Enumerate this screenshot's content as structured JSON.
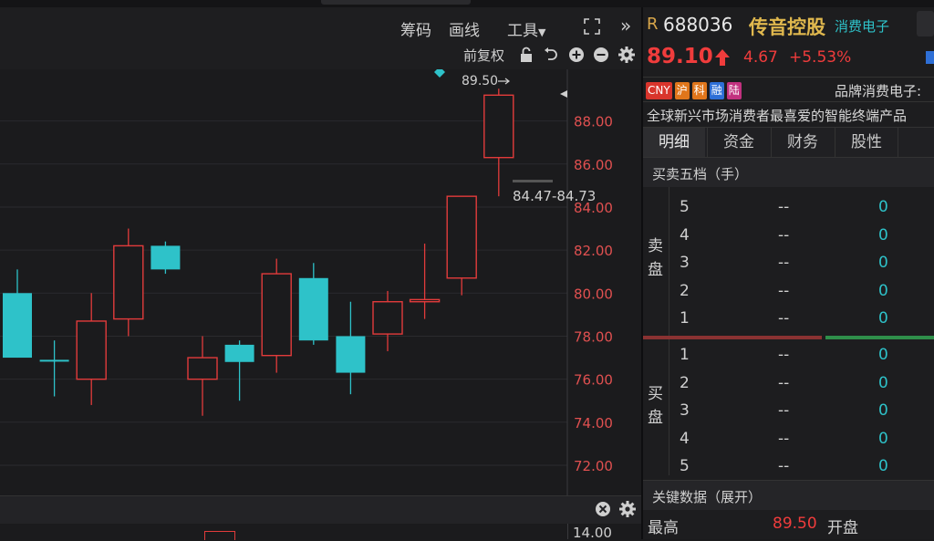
{
  "toolbar": {
    "chips_label": "筹码",
    "draw_label": "画线",
    "tools_label": "工具",
    "adjust_label": "前复权",
    "collapse_symbol": "»"
  },
  "chart": {
    "high_marker": "89.50",
    "range_label": "84.47-84.73",
    "y_ticks": [
      "88.00",
      "86.00",
      "84.00",
      "82.00",
      "80.00",
      "78.00",
      "76.00",
      "74.00",
      "72.00"
    ],
    "lower_first_tick": "14.00"
  },
  "chart_data": {
    "type": "candlestick",
    "ylim": [
      70.6,
      90.4
    ],
    "up_color": "#e23b3b",
    "down_color": "#2ec2c9",
    "candles": [
      {
        "o": 77.0,
        "c": 80.0,
        "h": 81.1,
        "l": 77.0,
        "dir": "down"
      },
      {
        "o": 76.9,
        "c": 76.9,
        "h": 77.8,
        "l": 75.2,
        "dir": "down"
      },
      {
        "o": 76.0,
        "c": 78.7,
        "h": 80.0,
        "l": 74.8,
        "dir": "up"
      },
      {
        "o": 78.8,
        "c": 82.2,
        "h": 83.0,
        "l": 78.0,
        "dir": "up"
      },
      {
        "o": 82.2,
        "c": 81.1,
        "h": 82.4,
        "l": 80.9,
        "dir": "down"
      },
      {
        "o": 76.0,
        "c": 77.0,
        "h": 78.0,
        "l": 74.3,
        "dir": "up"
      },
      {
        "o": 77.6,
        "c": 76.8,
        "h": 77.8,
        "l": 75.0,
        "dir": "down"
      },
      {
        "o": 77.1,
        "c": 80.9,
        "h": 81.6,
        "l": 76.3,
        "dir": "up"
      },
      {
        "o": 80.7,
        "c": 77.8,
        "h": 81.4,
        "l": 77.6,
        "dir": "down"
      },
      {
        "o": 78.0,
        "c": 76.3,
        "h": 79.6,
        "l": 75.3,
        "dir": "down"
      },
      {
        "o": 78.1,
        "c": 79.6,
        "h": 80.1,
        "l": 77.3,
        "dir": "up"
      },
      {
        "o": 79.6,
        "c": 79.7,
        "h": 82.3,
        "l": 78.8,
        "dir": "up"
      },
      {
        "o": 80.7,
        "c": 84.5,
        "h": 84.5,
        "l": 79.9,
        "dir": "up"
      },
      {
        "o": 86.3,
        "c": 89.2,
        "h": 89.5,
        "l": 84.5,
        "dir": "up"
      }
    ]
  },
  "stock": {
    "market_prefix": "R",
    "code": "688036",
    "name": "传音控股",
    "sector": "消费电子",
    "price": "89.10",
    "change": "4.67",
    "change_pct": "+5.53%",
    "tags": [
      "CNY",
      "沪",
      "科",
      "融",
      "陆"
    ],
    "tag_colors": [
      "#d9352c",
      "#e0761b",
      "#e0761b",
      "#2e6fd6",
      "#c2317f"
    ],
    "concept": "品牌消费电子:",
    "description": "全球新兴市场消费者最喜爱的智能终端产品"
  },
  "tabs": [
    "明细",
    "资金",
    "财务",
    "股性"
  ],
  "orderbook": {
    "title": "买卖五档（手）",
    "sell_label": [
      "卖",
      "盘"
    ],
    "buy_label": [
      "买",
      "盘"
    ],
    "sell_levels": [
      {
        "level": "5",
        "price": "--",
        "volume": "0"
      },
      {
        "level": "4",
        "price": "--",
        "volume": "0"
      },
      {
        "level": "3",
        "price": "--",
        "volume": "0"
      },
      {
        "level": "2",
        "price": "--",
        "volume": "0"
      },
      {
        "level": "1",
        "price": "--",
        "volume": "0"
      }
    ],
    "buy_levels": [
      {
        "level": "1",
        "price": "--",
        "volume": "0"
      },
      {
        "level": "2",
        "price": "--",
        "volume": "0"
      },
      {
        "level": "3",
        "price": "--",
        "volume": "0"
      },
      {
        "level": "4",
        "price": "--",
        "volume": "0"
      },
      {
        "level": "5",
        "price": "--",
        "volume": "0"
      }
    ]
  },
  "key_data": {
    "title": "关键数据（展开）",
    "high_label": "最高",
    "high_value": "89.50",
    "open_label": "开盘"
  }
}
